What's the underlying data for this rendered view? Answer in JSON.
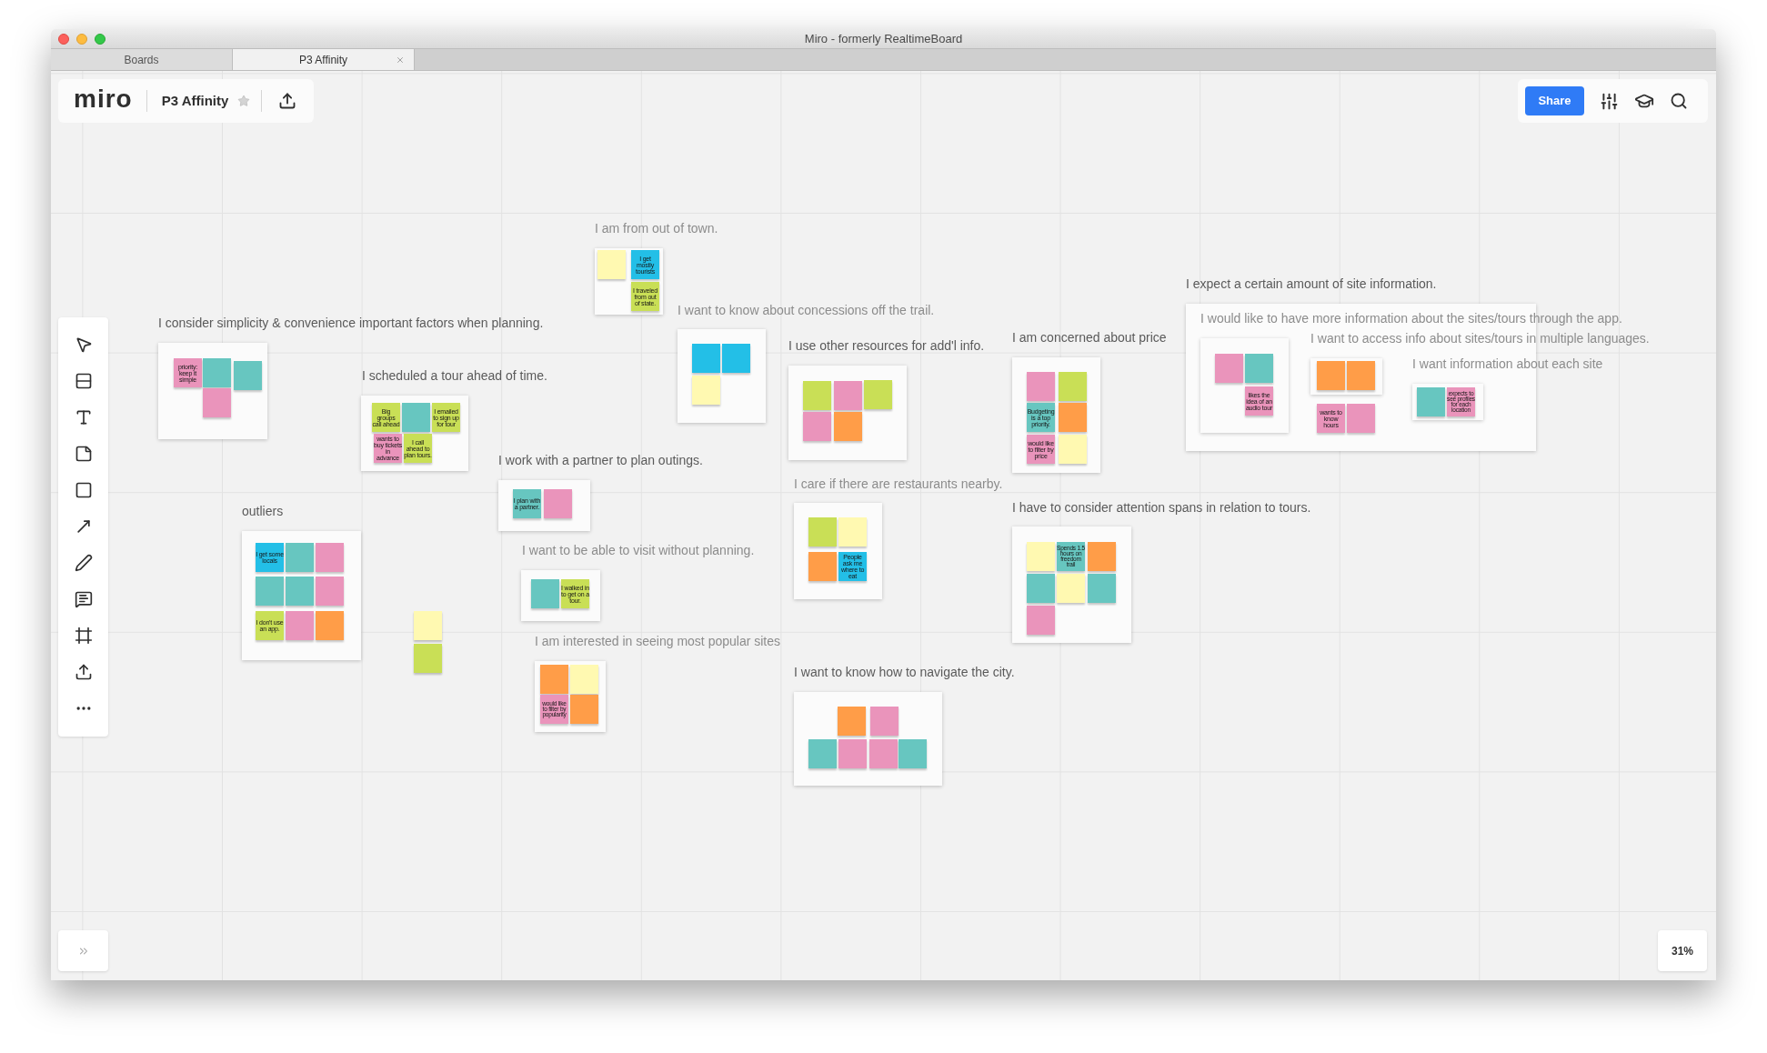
{
  "window": {
    "title": "Miro - formerly RealtimeBoard"
  },
  "tabs": [
    {
      "label": "Boards",
      "selected": false
    },
    {
      "label": "P3 Affinity",
      "selected": true
    }
  ],
  "board_bar": {
    "logo": "miro",
    "board_name": "P3 Affinity",
    "starred": false
  },
  "share_button": "Share",
  "zoom": "31%",
  "clusters": [
    {
      "heading": "I am from out of town.",
      "faded": true,
      "notes": [
        {
          "color": "#fff9b1"
        },
        {
          "text": "I get mostly tourists",
          "color": "#23bfe7"
        },
        {
          "text": "I traveled from out of state.",
          "color": "#c9df56"
        }
      ]
    },
    {
      "heading": "I expect a certain amount of site information.",
      "faded": false,
      "notes": [
        {
          "text": "wants to know hours",
          "color": "#ea94bb"
        },
        {
          "color": "#ea94bb"
        }
      ],
      "subclusters": [
        {
          "heading": "I would like to have more information about the sites/tours through the app.",
          "faded": true,
          "notes": [
            {
              "color": "#ea94bb"
            },
            {
              "color": "#67c6c0"
            },
            {
              "text": "likes the idea of an audio tour",
              "color": "#ea94bb"
            }
          ]
        },
        {
          "heading": "I want to access info about sites/tours in multiple languages.",
          "faded": true,
          "notes": [
            {
              "color": "#ff9d48"
            },
            {
              "color": "#ff9d48"
            }
          ]
        },
        {
          "heading": "I want information about each site",
          "faded": true,
          "notes": [
            {
              "color": "#67c6c0"
            },
            {
              "text": "expects to see profiles for each location",
              "color": "#ea94bb"
            }
          ]
        }
      ]
    },
    {
      "heading": "I want to know about concessions off the trail.",
      "faded": true,
      "notes": [
        {
          "color": "#23bfe7"
        },
        {
          "color": "#23bfe7"
        },
        {
          "color": "#fff9b1"
        }
      ]
    },
    {
      "heading": "I consider simplicity & convenience important factors when planning.",
      "faded": false,
      "notes": [
        {
          "text": "priority: keep it simple",
          "color": "#ea94bb"
        },
        {
          "color": "#67c6c0"
        },
        {
          "color": "#67c6c0"
        },
        {
          "color": "#ea94bb"
        }
      ]
    },
    {
      "heading": "I am concerned about price",
      "faded": false,
      "notes": [
        {
          "color": "#ea94bb"
        },
        {
          "color": "#c9df56"
        },
        {
          "text": "Budgeting is a top priority.",
          "color": "#67c6c0"
        },
        {
          "color": "#ff9d48"
        },
        {
          "text": "would like to filter by price",
          "color": "#ea94bb"
        },
        {
          "color": "#fff9b1"
        }
      ]
    },
    {
      "heading": "I use other resources for add'l info.",
      "faded": false,
      "notes": [
        {
          "color": "#c9df56"
        },
        {
          "color": "#ea94bb"
        },
        {
          "color": "#c9df56"
        },
        {
          "color": "#ea94bb"
        },
        {
          "color": "#ff9d48"
        }
      ]
    },
    {
      "heading": "I scheduled a tour ahead of time.",
      "faded": false,
      "notes": [
        {
          "text": "Big groups call ahead",
          "color": "#c9df56"
        },
        {
          "color": "#67c6c0"
        },
        {
          "text": "I emailed to sign up for tour",
          "color": "#c9df56"
        },
        {
          "text": "wants to buy tickets in advance",
          "color": "#ea94bb"
        },
        {
          "text": "I call ahead to plan tours.",
          "color": "#c9df56"
        }
      ]
    },
    {
      "heading": "I work with a partner to plan outings.",
      "faded": false,
      "notes": [
        {
          "text": "I plan with a partner.",
          "color": "#67c6c0"
        },
        {
          "color": "#ea94bb"
        }
      ]
    },
    {
      "heading": "I care if there are restaurants nearby.",
      "faded": true,
      "notes": [
        {
          "color": "#c9df56"
        },
        {
          "color": "#fff9b1"
        },
        {
          "color": "#ff9d48"
        },
        {
          "text": "People ask me where to eat",
          "color": "#23bfe7"
        }
      ]
    },
    {
      "heading": "outliers",
      "faded": false,
      "notes": [
        {
          "text": "I get some locals",
          "color": "#23bfe7"
        },
        {
          "color": "#67c6c0"
        },
        {
          "color": "#ea94bb"
        },
        {
          "color": "#67c6c0"
        },
        {
          "color": "#67c6c0"
        },
        {
          "color": "#ea94bb"
        },
        {
          "text": "I don't use an app.",
          "color": "#c9df56"
        },
        {
          "color": "#ea94bb"
        },
        {
          "color": "#ff9d48"
        }
      ]
    },
    {
      "heading": "I have to consider attention spans in relation to tours.",
      "faded": false,
      "notes": [
        {
          "color": "#fff9b1"
        },
        {
          "text": "Spends 1.5 hours on freedom trail",
          "color": "#67c6c0"
        },
        {
          "color": "#ff9d48"
        },
        {
          "color": "#67c6c0"
        },
        {
          "color": "#fff9b1"
        },
        {
          "color": "#67c6c0"
        },
        {
          "color": "#ea94bb"
        }
      ]
    },
    {
      "heading": "I want to be able to visit without planning.",
      "faded": true,
      "notes": [
        {
          "color": "#67c6c0"
        },
        {
          "text": "I walked in to get on a tour.",
          "color": "#c9df56"
        }
      ]
    },
    {
      "heading": "I am interested in seeing most popular sites",
      "faded": true,
      "notes": [
        {
          "color": "#ff9d48"
        },
        {
          "color": "#fff9b1"
        },
        {
          "text": "would like to filter by popularity",
          "color": "#ea94bb"
        },
        {
          "color": "#ff9d48"
        }
      ]
    },
    {
      "heading": "I want to know how to navigate the city.",
      "faded": false,
      "notes": [
        {
          "color": "#ff9d48"
        },
        {
          "color": "#ea94bb"
        },
        {
          "color": "#67c6c0"
        },
        {
          "color": "#ea94bb"
        },
        {
          "color": "#ea94bb"
        },
        {
          "color": "#67c6c0"
        }
      ]
    }
  ],
  "loose_notes": [
    {
      "color": "#fff9b1"
    },
    {
      "color": "#c9df56"
    }
  ]
}
